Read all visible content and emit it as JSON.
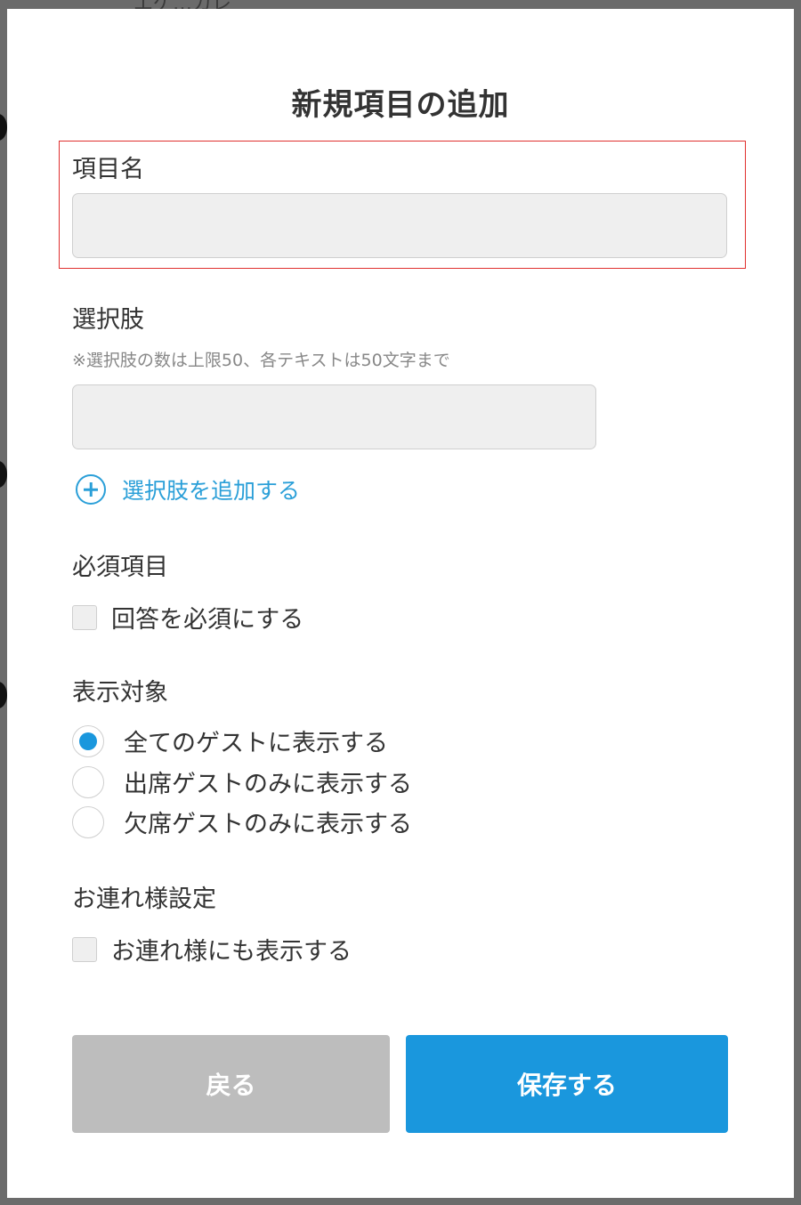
{
  "backdrop": {
    "peek_text": "エゲ…カレ"
  },
  "modal": {
    "title": "新規項目の追加",
    "item_name": {
      "label": "項目名",
      "value": "",
      "placeholder": ""
    },
    "choices": {
      "label": "選択肢",
      "note": "※選択肢の数は上限50、各テキストは50文字まで",
      "input_value": "",
      "add_label": "選択肢を追加する"
    },
    "required": {
      "label": "必須項目",
      "checkbox_label": "回答を必須にする",
      "checked": false
    },
    "display_target": {
      "label": "表示対象",
      "options": [
        {
          "label": "全てのゲストに表示する",
          "selected": true
        },
        {
          "label": "出席ゲストのみに表示する",
          "selected": false
        },
        {
          "label": "欠席ゲストのみに表示する",
          "selected": false
        }
      ]
    },
    "companion": {
      "label": "お連れ様設定",
      "checkbox_label": "お連れ様にも表示する",
      "checked": false
    },
    "buttons": {
      "back_label": "戻る",
      "save_label": "保存する"
    }
  },
  "colors": {
    "accent": "#1a97dd",
    "highlight_border": "#e0302f",
    "back_button": "#bdbdbd",
    "input_bg": "#efefef"
  }
}
